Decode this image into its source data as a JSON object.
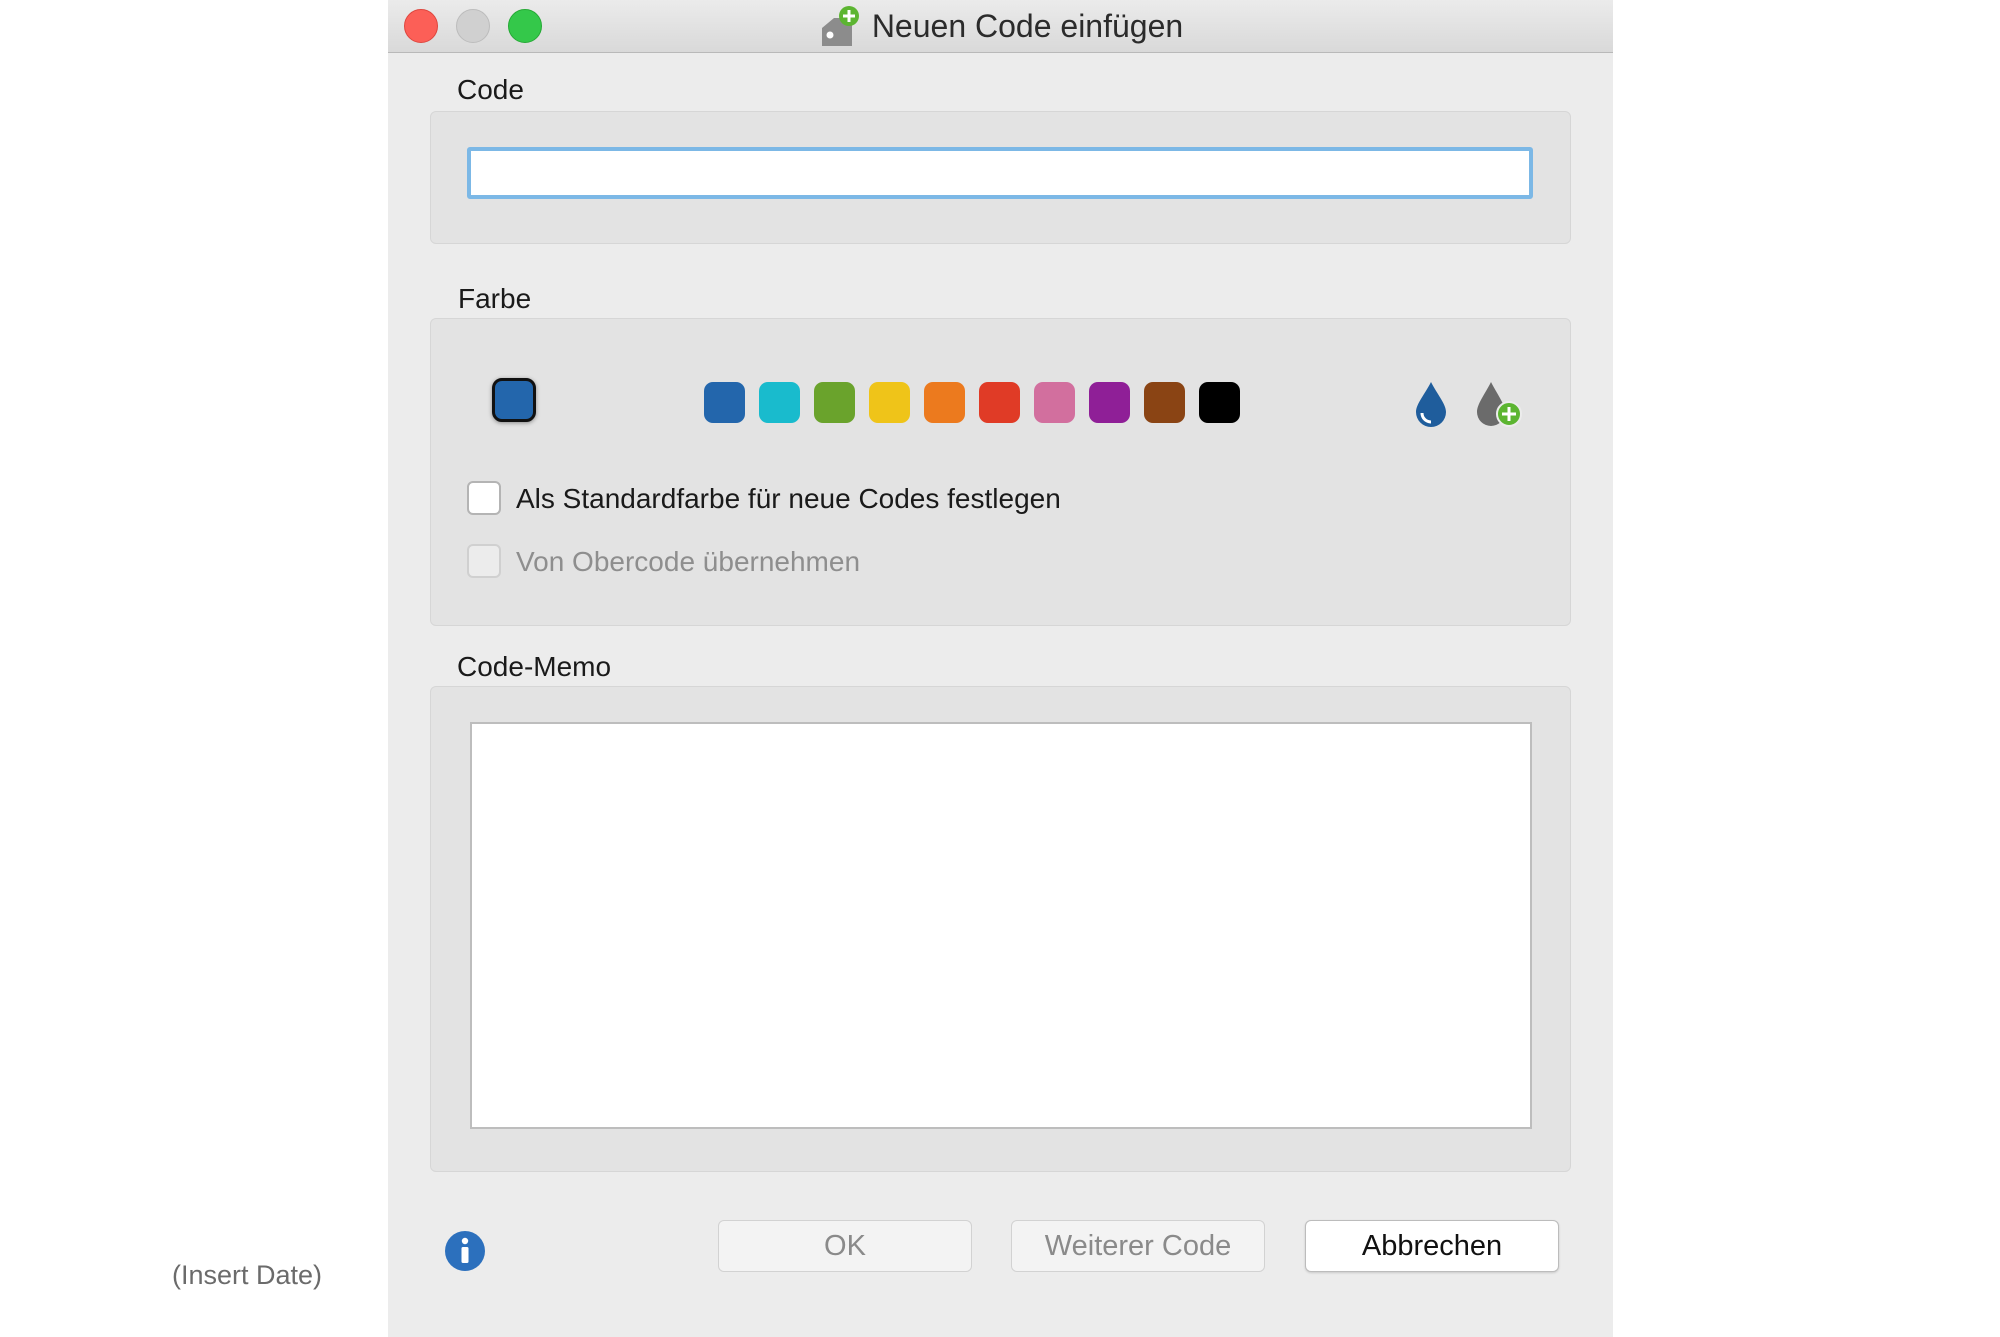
{
  "window": {
    "title": "Neuen Code einfügen",
    "title_icon": "add-code-icon"
  },
  "code_section": {
    "label": "Code",
    "value": "",
    "placeholder": ""
  },
  "color_section": {
    "label": "Farbe",
    "selected_color": "#2366ac",
    "palette": [
      {
        "name": "blue",
        "color": "#2366ac"
      },
      {
        "name": "cyan",
        "color": "#19bbcd"
      },
      {
        "name": "green",
        "color": "#6aa32c"
      },
      {
        "name": "yellow",
        "color": "#efc419"
      },
      {
        "name": "orange",
        "color": "#ec7a1e"
      },
      {
        "name": "red",
        "color": "#e03b26"
      },
      {
        "name": "pink",
        "color": "#d26f9e"
      },
      {
        "name": "purple",
        "color": "#8f1f97"
      },
      {
        "name": "brown",
        "color": "#8a4414"
      },
      {
        "name": "black",
        "color": "#000000"
      }
    ],
    "color_picker_icon": "water-drop-icon",
    "add_color_icon": "drop-add-icon",
    "default_color_checkbox": {
      "label": "Als Standardfarbe für neue Codes festlegen",
      "checked": false
    },
    "inherit_checkbox": {
      "label": "Von Obercode übernehmen",
      "checked": false,
      "disabled": true
    }
  },
  "memo_section": {
    "label": "Code-Memo",
    "value": ""
  },
  "footer": {
    "info_icon": "info-icon",
    "ok_label": "OK",
    "next_code_label": "Weiterer Code",
    "cancel_label": "Abbrechen"
  },
  "page_note": "(Insert Date)"
}
